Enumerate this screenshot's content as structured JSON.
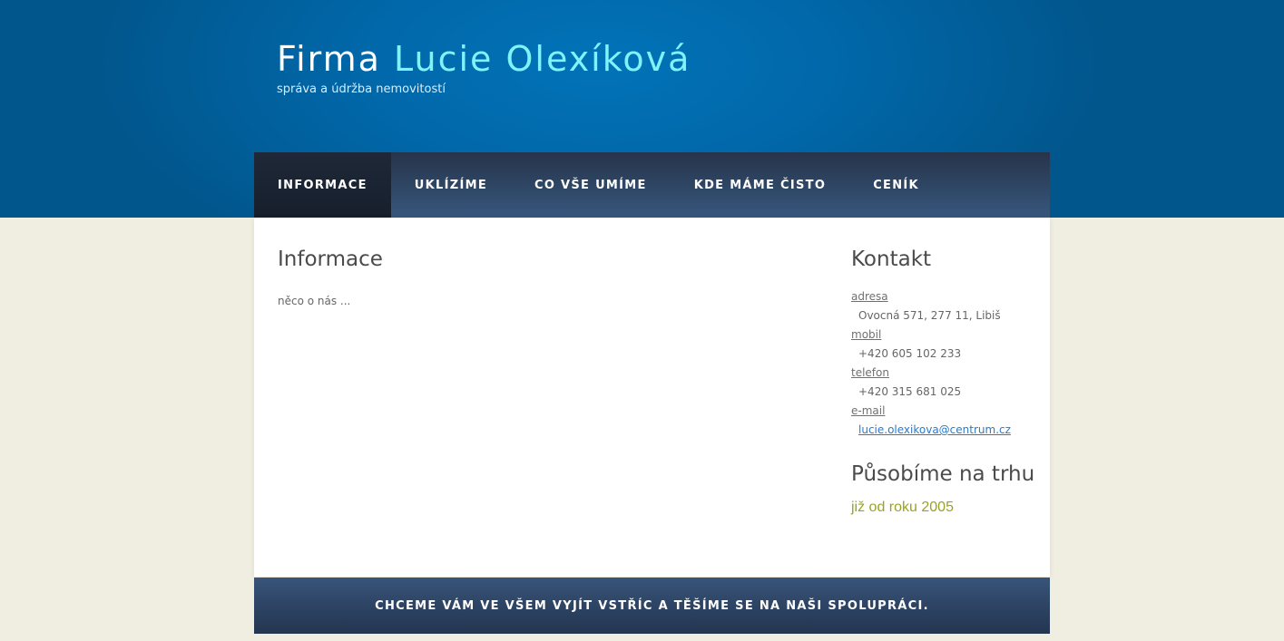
{
  "header": {
    "title_prefix": "Firma",
    "title_name": "Lucie Olexíková",
    "tagline": "správa a údržba nemovitostí"
  },
  "nav": {
    "items": [
      {
        "label": "Informace",
        "active": true
      },
      {
        "label": "Uklízíme",
        "active": false
      },
      {
        "label": "Co vše umíme",
        "active": false
      },
      {
        "label": "Kde máme čisto",
        "active": false
      },
      {
        "label": "Ceník",
        "active": false
      }
    ]
  },
  "main": {
    "heading": "Informace",
    "text": "něco o nás ..."
  },
  "sidebar": {
    "contact_heading": "Kontakt",
    "contacts": [
      {
        "label": "adresa",
        "value": "Ovocná 571, 277 11, Libiš"
      },
      {
        "label": "mobil",
        "value": "+420 605 102 233"
      },
      {
        "label": "telefon",
        "value": "+420 315 681 025"
      },
      {
        "label": "e-mail",
        "value": "lucie.olexikova@centrum.cz"
      }
    ],
    "market_heading": "Působíme na trhu",
    "market_text": "již od roku 2005"
  },
  "footer": {
    "text": "Chceme vám ve všem vyjít vstříc a těšíme se na naši spolupráci."
  },
  "colors": {
    "header_blue": "#0168aa",
    "title_accent": "#7ff3f8",
    "nav_dark": "#2f4766",
    "page_background": "#f0ede1",
    "link": "#2a7ac9",
    "highlight_text": "#9aa224"
  }
}
